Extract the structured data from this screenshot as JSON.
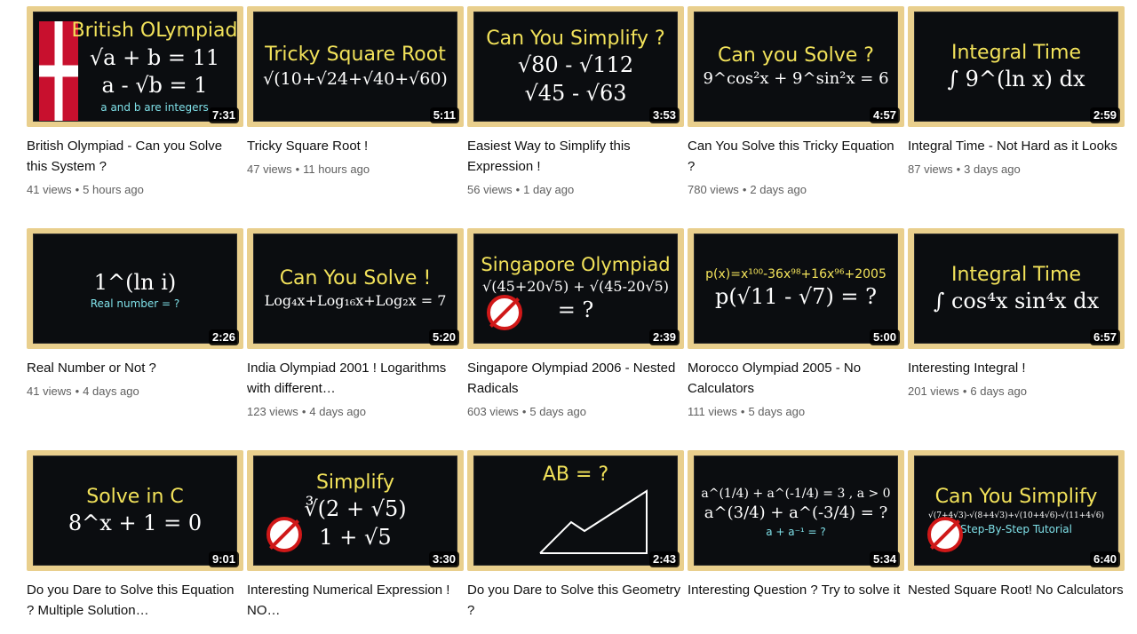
{
  "videos": [
    {
      "thumb_head": "British OLympiad",
      "thumb_math": "√a + b = 11",
      "thumb_math2": "a - √b = 1",
      "thumb_sub": "a and b are integers",
      "flag": true,
      "duration": "7:31",
      "title": "British Olympiad - Can you Solve this System ?",
      "views": "41 views",
      "age": "5 hours ago"
    },
    {
      "thumb_head": "Tricky Square Root",
      "thumb_math": "√(10+√24+√40+√60)",
      "thumb_math2": "",
      "thumb_sub": "",
      "duration": "5:11",
      "title": "Tricky Square Root !",
      "views": "47 views",
      "age": "11 hours ago"
    },
    {
      "thumb_head": "Can You Simplify ?",
      "thumb_math": "√80 - √112",
      "thumb_math2": "√45 - √63",
      "thumb_sub": "",
      "duration": "3:53",
      "title": "Easiest Way to Simplify this Expression !",
      "views": "56 views",
      "age": "1 day ago"
    },
    {
      "thumb_head": "Can you Solve ?",
      "thumb_math": "9^cos²x + 9^sin²x = 6",
      "thumb_math2": "",
      "thumb_sub": "",
      "duration": "4:57",
      "title": "Can You Solve this Tricky Equation ?",
      "views": "780 views",
      "age": "2 days ago"
    },
    {
      "thumb_head": "Integral Time",
      "thumb_math": "∫ 9^(ln x) dx",
      "thumb_math2": "",
      "thumb_sub": "",
      "duration": "2:59",
      "title": "Integral Time - Not Hard as it Looks",
      "views": "87 views",
      "age": "3 days ago"
    },
    {
      "thumb_head": "",
      "thumb_math": "1^(ln i)",
      "thumb_math2": "",
      "thumb_sub": "Real number = ?",
      "duration": "2:26",
      "title": "Real Number or Not ?",
      "views": "41 views",
      "age": "4 days ago"
    },
    {
      "thumb_head": "Can You Solve !",
      "thumb_math": "Log₄x+Log₁₆x+Log₂x = 7",
      "thumb_math2": "",
      "thumb_sub": "",
      "duration": "5:20",
      "title": "India Olympiad 2001 ! Logarithms with different…",
      "views": "123 views",
      "age": "4 days ago"
    },
    {
      "thumb_head": "Singapore Olympiad",
      "thumb_math": "√(45+20√5) + √(45-20√5)",
      "thumb_math2": "= ?",
      "thumb_sub": "",
      "noicon": true,
      "duration": "2:39",
      "title": "Singapore Olympiad 2006 - Nested Radicals",
      "views": "603 views",
      "age": "5 days ago"
    },
    {
      "thumb_head": "p(x)=x¹⁰⁰-36x⁹⁸+16x⁹⁶+2005",
      "thumb_math": "p(√11 - √7) = ?",
      "thumb_math2": "",
      "thumb_sub": "",
      "duration": "5:00",
      "title": "Morocco Olympiad 2005 - No Calculators",
      "views": "111 views",
      "age": "5 days ago"
    },
    {
      "thumb_head": "Integral Time",
      "thumb_math": "∫ cos⁴x sin⁴x dx",
      "thumb_math2": "",
      "thumb_sub": "",
      "duration": "6:57",
      "title": "Interesting Integral !",
      "views": "201 views",
      "age": "6 days ago"
    },
    {
      "thumb_head": "Solve in C",
      "thumb_math": "8^x + 1 = 0",
      "thumb_math2": "",
      "thumb_sub": "",
      "duration": "9:01",
      "title": "Do you Dare to Solve this Equation ? Multiple Solution…",
      "views": "",
      "age": ""
    },
    {
      "thumb_head": "Simplify",
      "thumb_math": "∛(2 + √5)",
      "thumb_math2": "1 + √5",
      "thumb_sub": "",
      "noicon": true,
      "duration": "3:30",
      "title": "Interesting Numerical Expression ! NO…",
      "views": "",
      "age": ""
    },
    {
      "thumb_head": "AB = ?",
      "thumb_math": "",
      "thumb_math2": "",
      "thumb_sub": "",
      "geometry": true,
      "duration": "2:43",
      "title": "Do you Dare to Solve this Geometry ?",
      "views": "",
      "age": ""
    },
    {
      "thumb_head": "",
      "thumb_math": "a^(1/4) + a^(-1/4) = 3 , a > 0",
      "thumb_math2": "a^(3/4) + a^(-3/4) = ?",
      "thumb_sub": "a + a⁻¹ = ?",
      "duration": "5:34",
      "title": "Interesting Question ? Try to solve it",
      "views": "",
      "age": ""
    },
    {
      "thumb_head": "Can You Simplify",
      "thumb_math": "√(7+4√3)-√(8+4√3)+√(10+4√6)-√(11+4√6)",
      "thumb_math2": "",
      "thumb_sub": "Step-By-Step Tutorial",
      "noicon": true,
      "duration": "6:40",
      "title": "Nested Square Root! No Calculators",
      "views": "",
      "age": ""
    }
  ]
}
